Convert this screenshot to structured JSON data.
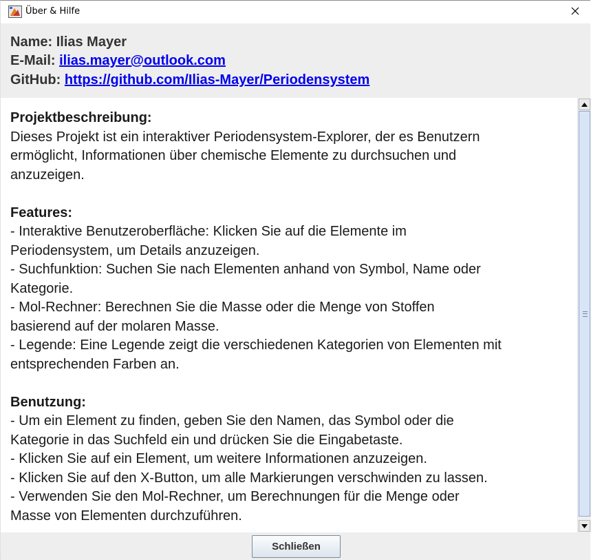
{
  "window": {
    "title": "Über & Hilfe",
    "icon": "app-icon",
    "close_icon": "close-icon"
  },
  "info": {
    "name_label": "Name:",
    "name_value": "Ilias Mayer",
    "email_label": "E-Mail:",
    "email_value": "ilias.mayer@outlook.com",
    "github_label": "GitHub:",
    "github_value": "https://github.com/Ilias-Mayer/Periodensystem"
  },
  "description": {
    "lines": [
      {
        "text": "Projektbeschreibung:",
        "bold": true
      },
      {
        "text": "Dieses Projekt ist ein interaktiver Periodensystem-Explorer, der es Benutzern",
        "bold": false
      },
      {
        "text": "ermöglicht, Informationen über chemische Elemente zu durchsuchen und",
        "bold": false
      },
      {
        "text": "anzuzeigen.",
        "bold": false
      },
      {
        "text": "",
        "bold": false
      },
      {
        "text": "Features:",
        "bold": true
      },
      {
        "text": "- Interaktive Benutzeroberfläche: Klicken Sie auf die Elemente im",
        "bold": false
      },
      {
        "text": "Periodensystem, um Details anzuzeigen.",
        "bold": false
      },
      {
        "text": "- Suchfunktion: Suchen Sie nach Elementen anhand von Symbol, Name oder",
        "bold": false
      },
      {
        "text": "Kategorie.",
        "bold": false
      },
      {
        "text": "- Mol-Rechner: Berechnen Sie die Masse oder die Menge von Stoffen",
        "bold": false
      },
      {
        "text": "basierend auf der molaren Masse.",
        "bold": false
      },
      {
        "text": "- Legende: Eine Legende zeigt die verschiedenen Kategorien von Elementen mit",
        "bold": false
      },
      {
        "text": "entsprechenden Farben an.",
        "bold": false
      },
      {
        "text": "",
        "bold": false
      },
      {
        "text": "Benutzung:",
        "bold": true
      },
      {
        "text": "- Um ein Element zu finden, geben Sie den Namen, das Symbol oder die",
        "bold": false
      },
      {
        "text": "Kategorie in das Suchfeld ein und drücken Sie die Eingabetaste.",
        "bold": false
      },
      {
        "text": "- Klicken Sie auf ein Element, um weitere Informationen anzuzeigen.",
        "bold": false
      },
      {
        "text": "- Klicken Sie auf den X-Button, um alle Markierungen verschwinden zu lassen.",
        "bold": false
      },
      {
        "text": "- Verwenden Sie den Mol-Rechner, um Berechnungen für die Menge oder",
        "bold": false
      },
      {
        "text": "Masse von Elementen durchzuführen.",
        "bold": false
      }
    ]
  },
  "footer": {
    "close_label": "Schließen"
  },
  "colors": {
    "link": "#0000ee",
    "panel_bg": "#eeeeee",
    "scroll_thumb": "#d9e5f6"
  }
}
